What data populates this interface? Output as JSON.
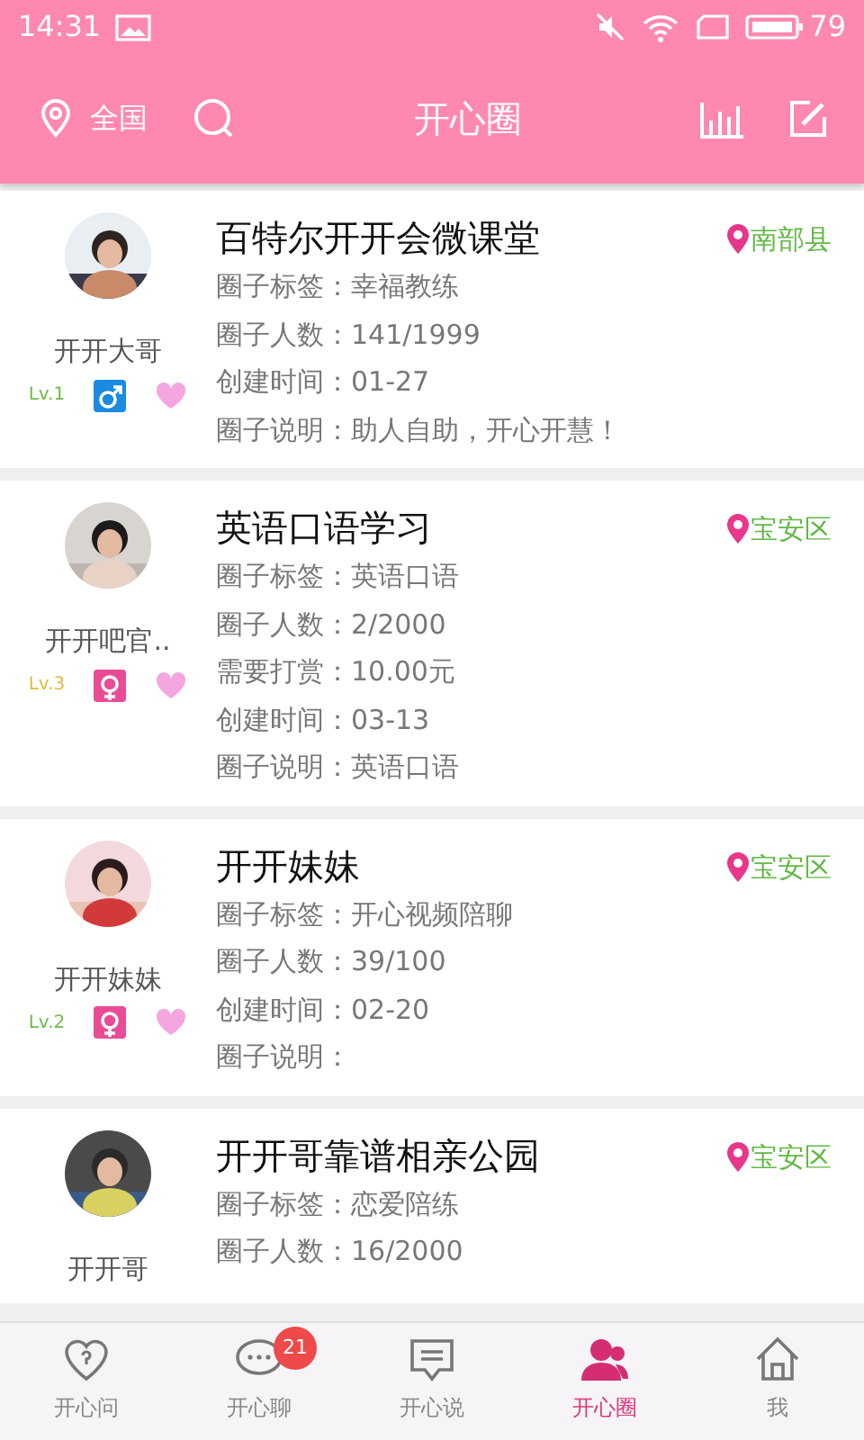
{
  "status_bar": {
    "time": "14:31",
    "battery": "79"
  },
  "header": {
    "location": "全国",
    "title": "开心圈"
  },
  "circles": [
    {
      "owner": "开开大哥",
      "level": "Lv.1",
      "color": "#6dbd45",
      "kind": "male",
      "title": "百特尔开开会微课堂",
      "place": "南部县",
      "rows": [
        "圈子标签：幸福教练",
        "圈子人数：141/1999",
        "创建时间：01-27",
        "圈子说明：助人自助，开心开慧！"
      ]
    },
    {
      "owner": "开开吧官..",
      "level": "Lv.3",
      "color": "#e3b93b",
      "kind": "female",
      "title": "英语口语学习",
      "place": "宝安区",
      "rows": [
        "圈子标签：英语口语",
        "圈子人数：2/2000",
        "需要打赏：10.00元",
        "创建时间：03-13",
        "圈子说明：英语口语"
      ]
    },
    {
      "owner": "开开妹妹",
      "level": "Lv.2",
      "color": "#6dbd45",
      "kind": "female",
      "title": "开开妹妹",
      "place": "宝安区",
      "rows": [
        "圈子标签：开心视频陪聊",
        "圈子人数：39/100",
        "创建时间：02-20",
        "圈子说明："
      ]
    },
    {
      "owner": "开开哥",
      "title": "开开哥靠谱相亲公园",
      "place": "宝安区",
      "rows": [
        "圈子标签：恋爱陪练",
        "圈子人数：16/2000"
      ]
    }
  ],
  "tab_bar": [
    {
      "label": "开心问",
      "kind": "heart",
      "selected": false
    },
    {
      "label": "开心聊",
      "kind": "chat",
      "selected": false,
      "badge": "21"
    },
    {
      "label": "开心说",
      "kind": "message",
      "selected": false
    },
    {
      "label": "开心圈",
      "kind": "people",
      "selected": true
    },
    {
      "label": "我",
      "kind": "home",
      "selected": false
    }
  ]
}
